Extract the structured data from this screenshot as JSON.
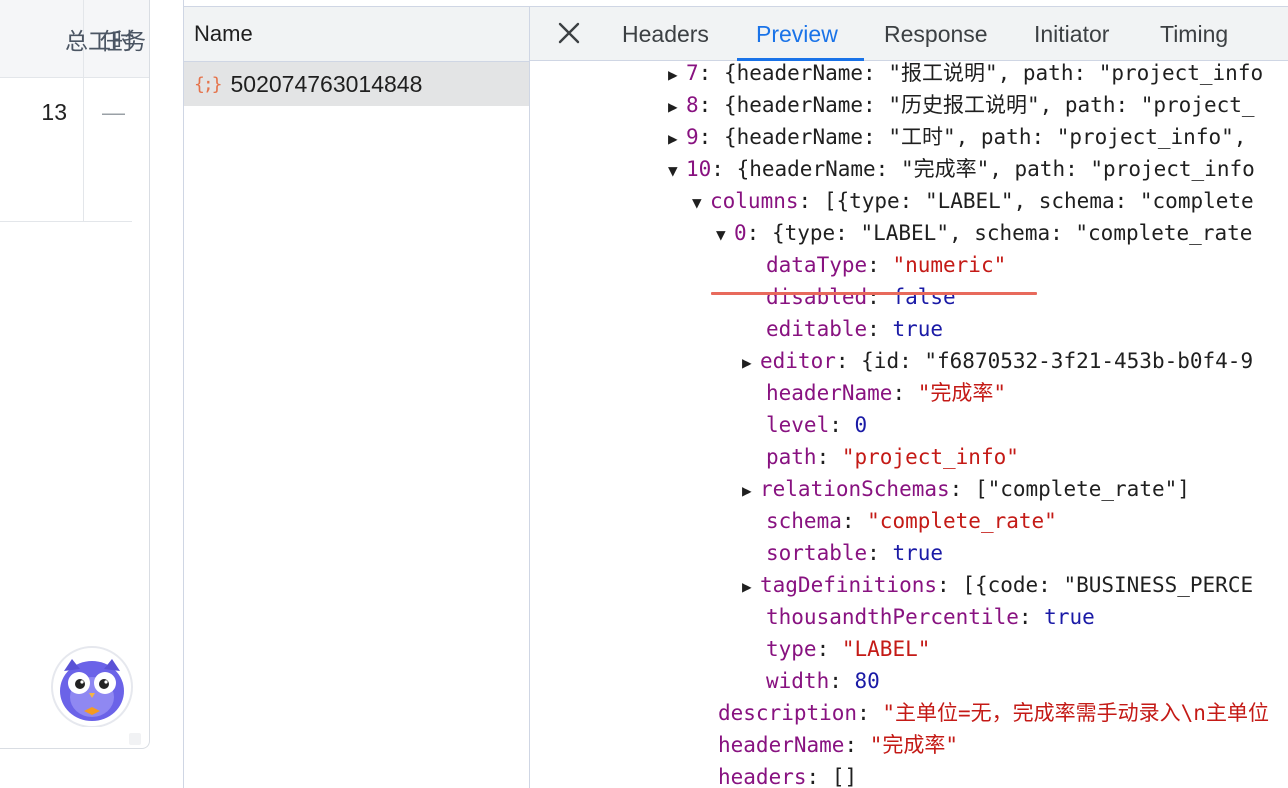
{
  "app_table": {
    "headers": [
      "总工时",
      "任务"
    ],
    "row": [
      "13",
      "—"
    ]
  },
  "devtools": {
    "name_column_header": "Name",
    "request": {
      "icon": "{;}",
      "name": "502074763014848"
    },
    "tabs": [
      "Headers",
      "Preview",
      "Response",
      "Initiator",
      "Timing"
    ],
    "active_tab": "Preview",
    "accent_color": "#1a73e8"
  },
  "preview": {
    "items": {
      "i7": {
        "index": "7",
        "summary": "{headerName: \"报工说明\", path: \"project_info"
      },
      "i8": {
        "index": "8",
        "summary": "{headerName: \"历史报工说明\", path: \"project_"
      },
      "i9": {
        "index": "9",
        "summary": "{headerName: \"工时\", path: \"project_info\","
      },
      "i10": {
        "index": "10",
        "summary": "{headerName: \"完成率\", path: \"project_info"
      }
    },
    "columns": {
      "key": "columns",
      "summary": "[{type: \"LABEL\", schema: \"complete"
    },
    "col0": {
      "index": "0",
      "summary": "{type: \"LABEL\", schema: \"complete_rate"
    },
    "props": {
      "dataType": {
        "key": "dataType",
        "value": "\"numeric\""
      },
      "disabled": {
        "key": "disabled",
        "value": "false"
      },
      "editable": {
        "key": "editable",
        "value": "true"
      },
      "editor": {
        "key": "editor",
        "value": "{id: \"f6870532-3f21-453b-b0f4-9"
      },
      "headerName": {
        "key": "headerName",
        "value": "\"完成率\""
      },
      "level": {
        "key": "level",
        "value": "0"
      },
      "path": {
        "key": "path",
        "value": "\"project_info\""
      },
      "relationSchemas": {
        "key": "relationSchemas",
        "value": "[\"complete_rate\"]"
      },
      "schema": {
        "key": "schema",
        "value": "\"complete_rate\""
      },
      "sortable": {
        "key": "sortable",
        "value": "true"
      },
      "tagDefinitions": {
        "key": "tagDefinitions",
        "value": "[{code: \"BUSINESS_PERCE"
      },
      "thousandthPercentile": {
        "key": "thousandthPercentile",
        "value": "true"
      },
      "type": {
        "key": "type",
        "value": "\"LABEL\""
      },
      "width": {
        "key": "width",
        "value": "80"
      }
    },
    "after": {
      "description": {
        "key": "description",
        "value": "\"主单位=无，完成率需手动录入\\n主单位"
      },
      "headerName": {
        "key": "headerName",
        "value": "\"完成率\""
      },
      "headers": {
        "key": "headers",
        "value": "[]"
      }
    }
  }
}
